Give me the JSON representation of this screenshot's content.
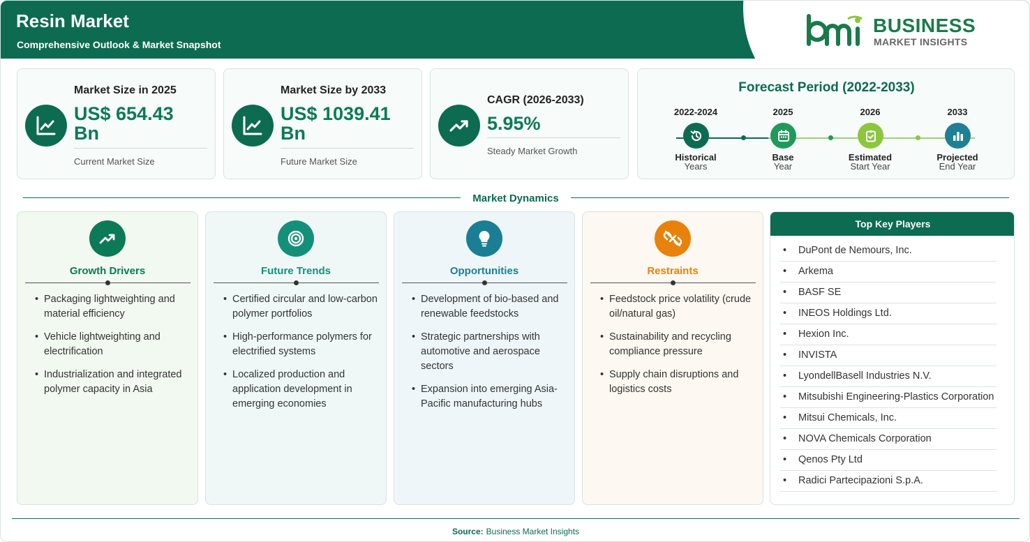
{
  "header": {
    "title": "Resin Market",
    "subtitle": "Comprehensive Outlook & Market Snapshot",
    "logo_line1": "BUSINESS",
    "logo_line2": "MARKET INSIGHTS"
  },
  "stats": [
    {
      "label": "Market Size in 2025",
      "value_line1": "US$ 654.43",
      "value_line2": "Bn",
      "note": "Current Market Size",
      "icon": "line-chart-icon"
    },
    {
      "label": "Market Size by 2033",
      "value_line1": "US$ 1039.41",
      "value_line2": "Bn",
      "note": "Future Market Size",
      "icon": "line-chart-icon"
    },
    {
      "label": "CAGR (2026-2033)",
      "value_line1": "5.95%",
      "note": "Steady Market Growth",
      "icon": "trend-up-icon"
    }
  ],
  "forecast": {
    "title": "Forecast Period (2022-2033)",
    "steps": [
      {
        "year": "2022-2024",
        "name": "Historical",
        "sub": "Years",
        "icon": "history-icon",
        "color": "#0c6b50"
      },
      {
        "year": "2025",
        "name": "Base",
        "sub": "Year",
        "icon": "calendar-icon",
        "color": "#1f9a5a"
      },
      {
        "year": "2026",
        "name": "Estimated",
        "sub": "Start Year",
        "icon": "clipboard-check-icon",
        "color": "#8cc63f"
      },
      {
        "year": "2033",
        "name": "Projected",
        "sub": "End Year",
        "icon": "bar-chart-icon",
        "color": "#1f7f95"
      }
    ]
  },
  "dynamics": {
    "title": "Market Dynamics",
    "columns": [
      {
        "title": "Growth Drivers",
        "color": "#0c7a56",
        "bg": "#f2f9f1",
        "icon": "trend-up-icon",
        "items": [
          "Packaging lightweighting and material efficiency",
          "Vehicle lightweighting and electrification",
          "Industrialization and integrated polymer capacity in Asia"
        ]
      },
      {
        "title": "Future Trends",
        "color": "#14907a",
        "bg": "#eff8f7",
        "icon": "target-icon",
        "items": [
          "Certified circular and low-carbon polymer portfolios",
          "High-performance polymers for electrified systems",
          "Localized production and application development in emerging economies"
        ]
      },
      {
        "title": "Opportunities",
        "color": "#1a7f95",
        "bg": "#eff6f9",
        "icon": "lightbulb-icon",
        "items": [
          "Development of bio-based and renewable feedstocks",
          "Strategic partnerships with automotive and aerospace sectors",
          "Expansion into emerging Asia-Pacific manufacturing hubs"
        ]
      },
      {
        "title": "Restraints",
        "color": "#e8820c",
        "bg": "#fdf8f1",
        "icon": "broken-link-icon",
        "items": [
          "Feedstock price volatility (crude oil/natural gas)",
          "Sustainability and recycling compliance pressure",
          "Supply chain disruptions and logistics costs"
        ]
      }
    ]
  },
  "players": {
    "title": "Top Key Players",
    "items": [
      "DuPont de Nemours, Inc.",
      "Arkema",
      "BASF SE",
      "INEOS Holdings Ltd.",
      "Hexion Inc.",
      "INVISTA",
      "LyondellBasell Industries N.V.",
      "Mitsubishi Engineering-Plastics Corporation",
      "Mitsui Chemicals, Inc.",
      "NOVA Chemicals Corporation",
      "Qenos Pty Ltd",
      "Radici Partecipazioni S.p.A."
    ]
  },
  "footer": {
    "source_label": "Source:",
    "source_value": "Business Market Insights"
  }
}
